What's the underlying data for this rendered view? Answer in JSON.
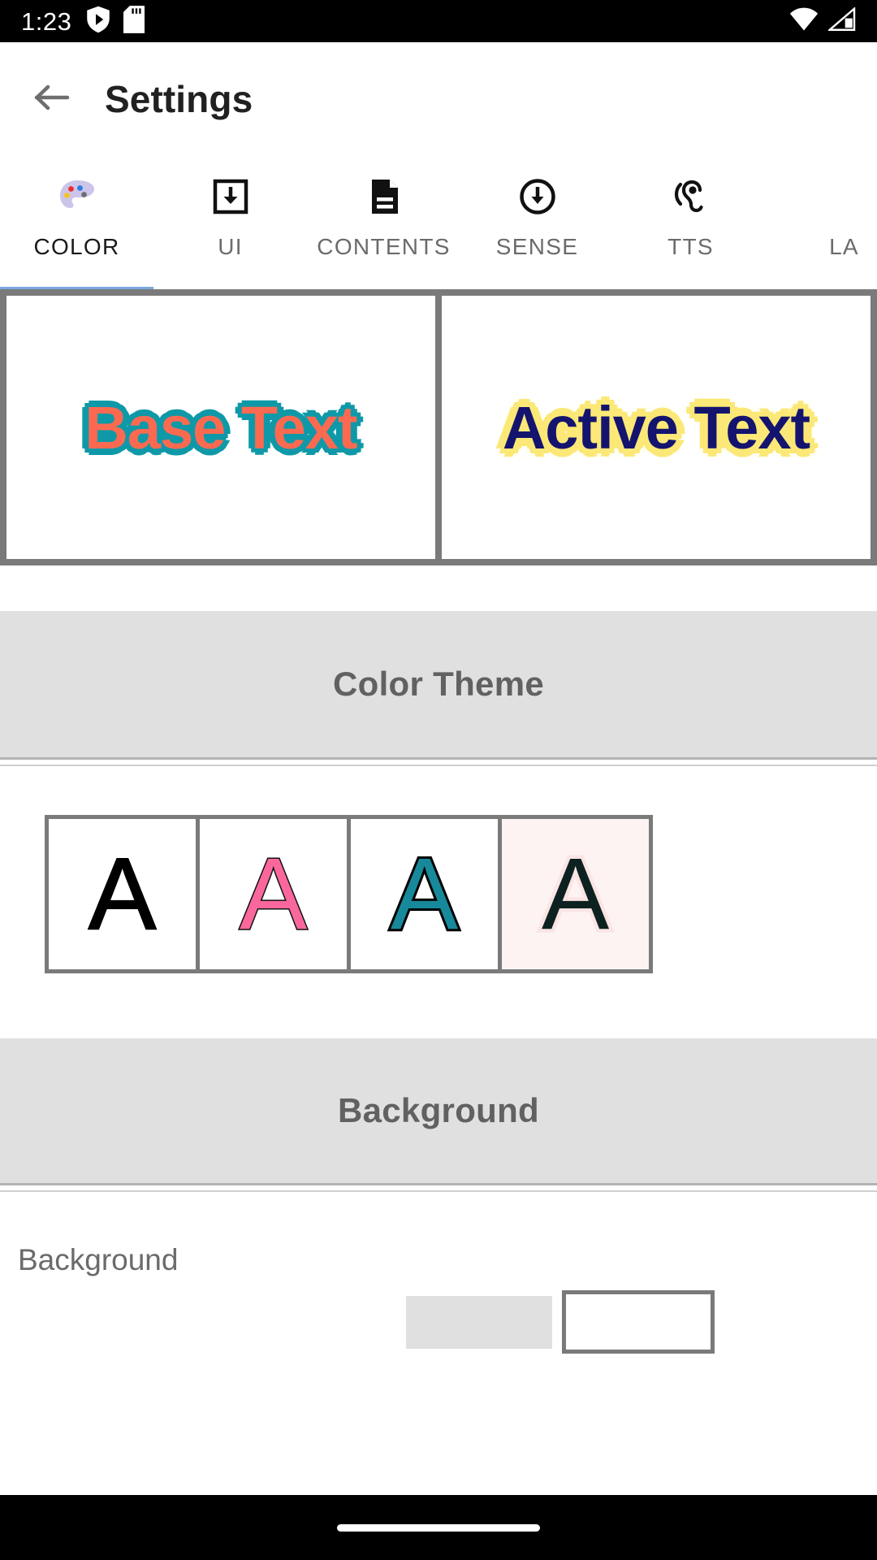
{
  "status_bar": {
    "clock": "1:23",
    "left_icons": [
      "shield-play-icon",
      "sd-card-icon"
    ],
    "right_icons": [
      "wifi-icon",
      "cellular-signal-icon"
    ]
  },
  "app_bar": {
    "back_icon": "back-arrow-icon",
    "title": "Settings"
  },
  "tabs": [
    {
      "label": "COLOR",
      "icon": "palette-icon",
      "active": true
    },
    {
      "label": "UI",
      "icon": "box-download-icon",
      "active": false
    },
    {
      "label": "CONTENTS",
      "icon": "document-icon",
      "active": false
    },
    {
      "label": "SENSE",
      "icon": "circle-download-icon",
      "active": false
    },
    {
      "label": "TTS",
      "icon": "hearing-ear-icon",
      "active": false
    },
    {
      "label": "LA",
      "icon": "",
      "active": false
    }
  ],
  "preview": {
    "base": {
      "text": "Base Text",
      "text_color": "#fb6a50",
      "outline_color": "#0f99a8",
      "background": "#ffffff"
    },
    "active": {
      "text": "Active Text",
      "text_color": "#14146e",
      "outline_color": "#fbe877",
      "background": "#ffffff"
    }
  },
  "sections": {
    "color_theme": {
      "title": "Color Theme",
      "header_bg": "#e0e0e0",
      "title_color": "#616161",
      "swatches": [
        {
          "glyph": "A",
          "fill": "#000000",
          "stroke": "#000000",
          "card_bg": "#ffffff",
          "selected": false
        },
        {
          "glyph": "A",
          "fill": "#f9679d",
          "stroke": "#111111",
          "card_bg": "#ffffff",
          "selected": false
        },
        {
          "glyph": "A",
          "fill": "#17899a",
          "stroke": "#000000",
          "card_bg": "#ffffff",
          "selected": false
        },
        {
          "glyph": "A",
          "fill": "#0d2220",
          "stroke": "#fbe4e4",
          "card_bg": "#fdf3f3",
          "selected": false
        }
      ]
    },
    "background": {
      "title": "Background",
      "header_bg": "#e0e0e0",
      "title_color": "#616161",
      "row_label": "Background",
      "chip_color": "#e0e0e0",
      "chip_outline_color": "#7a7a7a"
    }
  },
  "nav_bar": {
    "gesture_pill": "home-gesture-pill"
  }
}
